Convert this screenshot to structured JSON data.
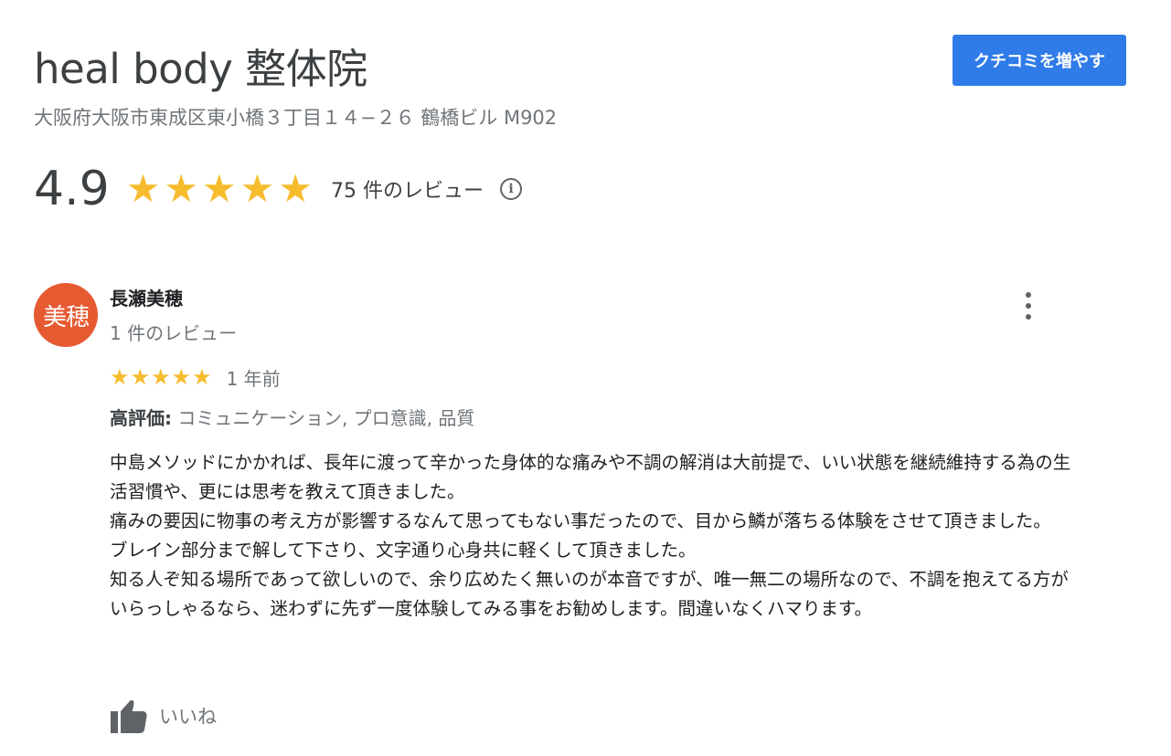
{
  "business": {
    "name": "heal body 整体院",
    "address": "大阪府大阪市東成区東小橋３丁目１４−２６ 鶴橋ビル M902",
    "add_review_button": "クチコミを増やす"
  },
  "rating": {
    "value": "4.9",
    "stars": 5,
    "count_text": "75 件のレビュー",
    "info_icon": "info-icon"
  },
  "review": {
    "avatar_text": "美穂",
    "avatar_color": "#e65a32",
    "reviewer_name": "長瀬美穂",
    "reviewer_meta": "1 件のレビュー",
    "stars": 5,
    "time_ago": "1 年前",
    "highlights_label": "高評価:",
    "highlights_value": " コミュニケーション, プロ意識, 品質",
    "text": "中島メソッドにかかれば、長年に渡って辛かった身体的な痛みや不調の解消は大前提で、いい状態を継続維持する為の生活習慣や、更には思考を教えて頂きました。\n痛みの要因に物事の考え方が影響するなんて思ってもない事だったので、目から鱗が落ちる体験をさせて頂きました。\nブレイン部分まで解して下さり、文字通り心身共に軽くして頂きました。\n知る人ぞ知る場所であって欲しいので、余り広めたく無いのが本音ですが、唯一無二の場所なので、不調を抱えてる方がいらっしゃるなら、迷わずに先ず一度体験してみる事をお勧めします。間違いなくハマります。",
    "like_label": "いいね",
    "more_icon": "more-vert-icon",
    "like_icon": "thumbs-up-icon"
  },
  "colors": {
    "accent": "#2f7be8",
    "star": "#f6bc2e",
    "muted_text": "#70757a"
  }
}
